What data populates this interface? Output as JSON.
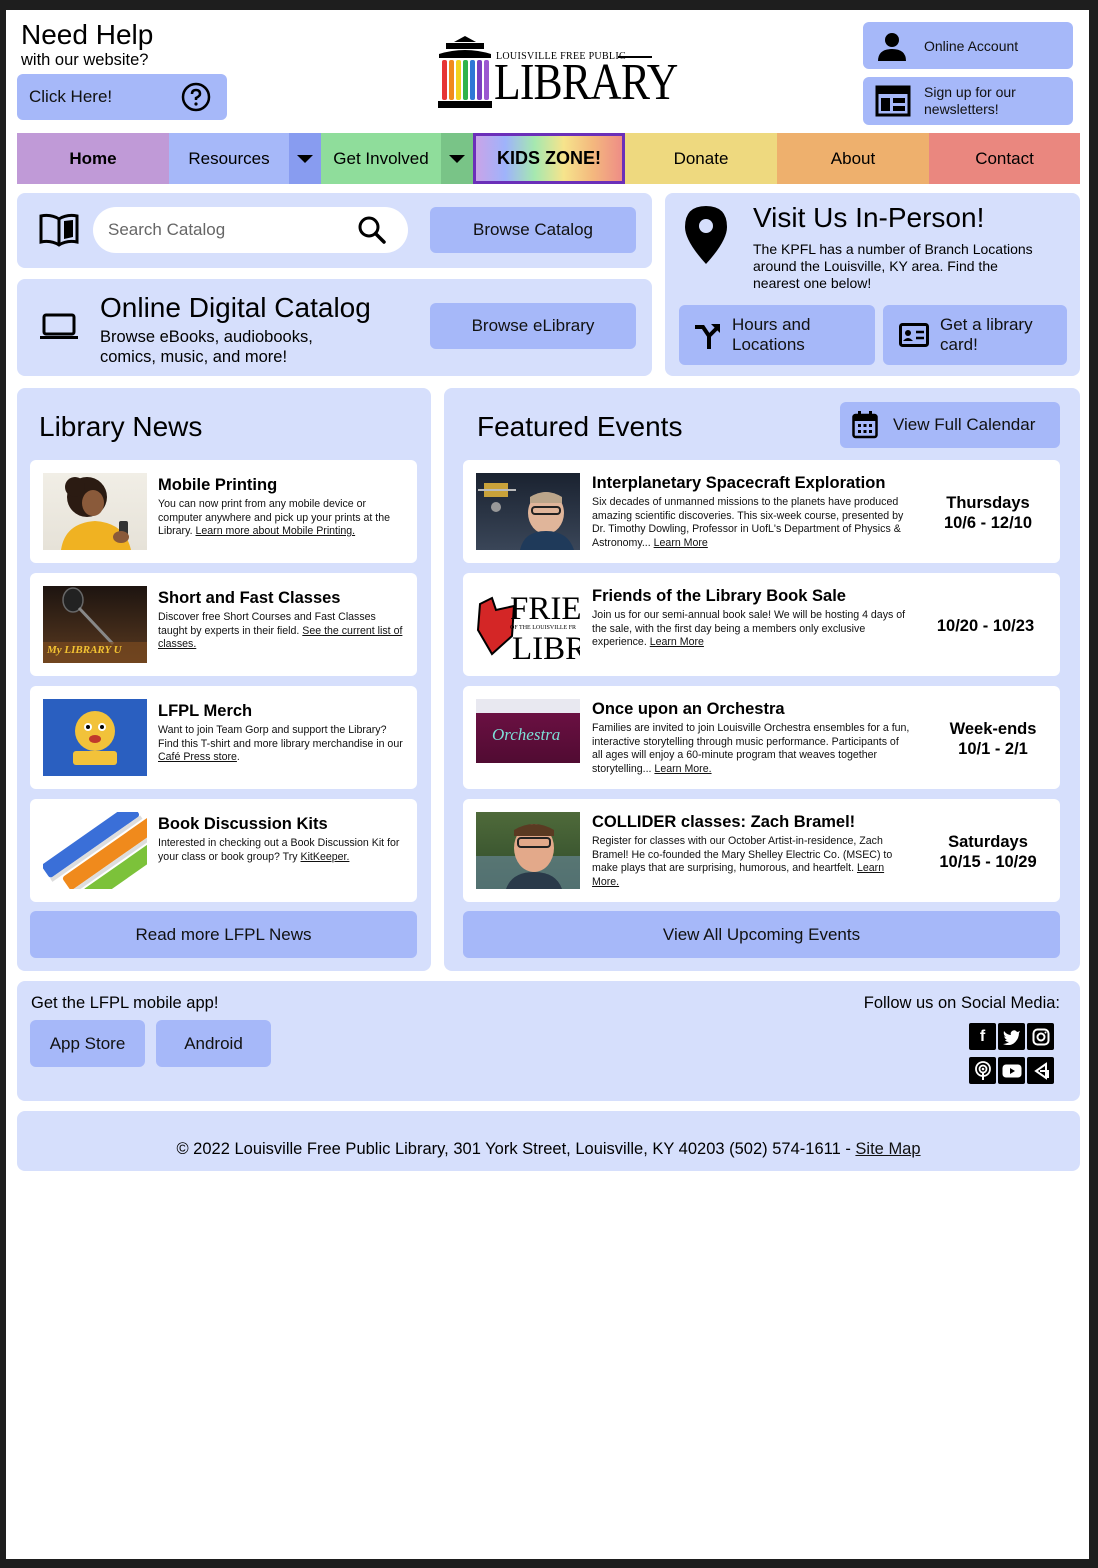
{
  "help": {
    "title": "Need Help",
    "subtitle": "with our website?",
    "button": "Click Here!"
  },
  "logo": {
    "top": "LOUISVILLE FREE PUBLIC",
    "main": "LIBRARY"
  },
  "account": {
    "online_account": "Online Account",
    "newsletter": "Sign up for our newsletters!"
  },
  "nav": {
    "items": [
      {
        "label": "Home",
        "color": "#c09ad7"
      },
      {
        "label": "Resources",
        "color": "#a6b8f9"
      },
      {
        "label": "Get Involved",
        "color": "#8fdd9b"
      },
      {
        "label": "KIDS ZONE!",
        "color": "rainbow"
      },
      {
        "label": "Donate",
        "color": "#eed97f"
      },
      {
        "label": "About",
        "color": "#eeb06d"
      },
      {
        "label": "Contact",
        "color": "#ea877f"
      }
    ]
  },
  "search": {
    "placeholder": "Search Catalog",
    "browse": "Browse Catalog"
  },
  "digital": {
    "title": "Online Digital Catalog",
    "desc": "Browse eBooks, audiobooks, comics, music, and more!",
    "button": "Browse eLibrary"
  },
  "visit": {
    "title": "Visit Us In-Person!",
    "desc": "The KPFL has a number of Branch Locations around the Louisville, KY area. Find the nearest one below!",
    "hours": "Hours and Locations",
    "card": "Get a library card!"
  },
  "news": {
    "title": "Library News",
    "items": [
      {
        "title": "Mobile Printing",
        "desc": "You can now print from any mobile device or computer anywhere and pick up your prints at the Library.",
        "link": "Learn more about Mobile Printing."
      },
      {
        "title": "Short and Fast Classes",
        "desc": "Discover free Short Courses and Fast Classes taught by experts in their field.",
        "link": "See the current list of classes.",
        "thumb_text": "My LIBRARY U"
      },
      {
        "title": "LFPL Merch",
        "desc": "Want to join Team Gorp and support the Library? Find this T-shirt and more library merchandise in our",
        "link": "Café Press store",
        "tail": "."
      },
      {
        "title": "Book Discussion Kits",
        "desc": "Interested in checking out a Book Discussion Kit for your class or book group? Try",
        "link": "KitKeeper."
      }
    ],
    "more": "Read more LFPL News"
  },
  "events": {
    "title": "Featured Events",
    "calendar": "View Full Calendar",
    "items": [
      {
        "title": "Interplanetary Spacecraft Exploration",
        "desc": "Six decades of unmanned missions to the planets have produced amazing scientific discoveries. This six-week course, presented by Dr. Timothy Dowling, Professor in UofL's Department of Physics & Astronomy...",
        "link": "Learn More",
        "when1": "Thursdays",
        "when2": "10/6 - 12/10"
      },
      {
        "title": "Friends of the Library Book Sale",
        "desc": "Join us for our semi-annual book sale! We will be hosting 4 days of the sale, with the first day being a members only exclusive experience.",
        "link": "Learn More",
        "when1": "",
        "when2": "10/20 - 10/23",
        "thumb_big1": "FRIEN",
        "thumb_small": "OF THE LOUISVILLE FR",
        "thumb_big2": "LIBRA"
      },
      {
        "title": "Once upon an Orchestra",
        "desc": "Families are invited to join Louisville Orchestra ensembles for a fun, interactive storytelling through music performance. Participants of all ages will enjoy a 60-minute program that weaves together storytelling...",
        "link": "Learn More.",
        "when1": "Week-ends",
        "when2": "10/1 - 2/1",
        "thumb_text": "Orchestra"
      },
      {
        "title": "COLLIDER classes: Zach Bramel!",
        "desc": "Register for classes with our October Artist-in-residence, Zach Bramel! He co-founded the Mary Shelley Electric Co. (MSEC) to make plays that are surprising, humorous, and heartfelt.",
        "link": "Learn More.",
        "when1": "Saturdays",
        "when2": "10/15 - 10/29"
      }
    ],
    "more": "View All Upcoming Events"
  },
  "app": {
    "label": "Get the LFPL mobile app!",
    "appstore": "App Store",
    "android": "Android"
  },
  "social": {
    "label": "Follow us on Social Media:",
    "icons": [
      "facebook-icon",
      "twitter-icon",
      "instagram-icon",
      "podcast-icon",
      "youtube-icon",
      "bandcamp-icon"
    ]
  },
  "footer": {
    "text": "© 2022 Louisville Free Public Library, 301 York Street, Louisville, KY 40203 (502) 574-1611 - ",
    "sitemap": "Site Map"
  },
  "colors": {
    "panel": "#d6dffc",
    "button": "#a6b8f9",
    "kids_border": "#6b2fb9"
  }
}
